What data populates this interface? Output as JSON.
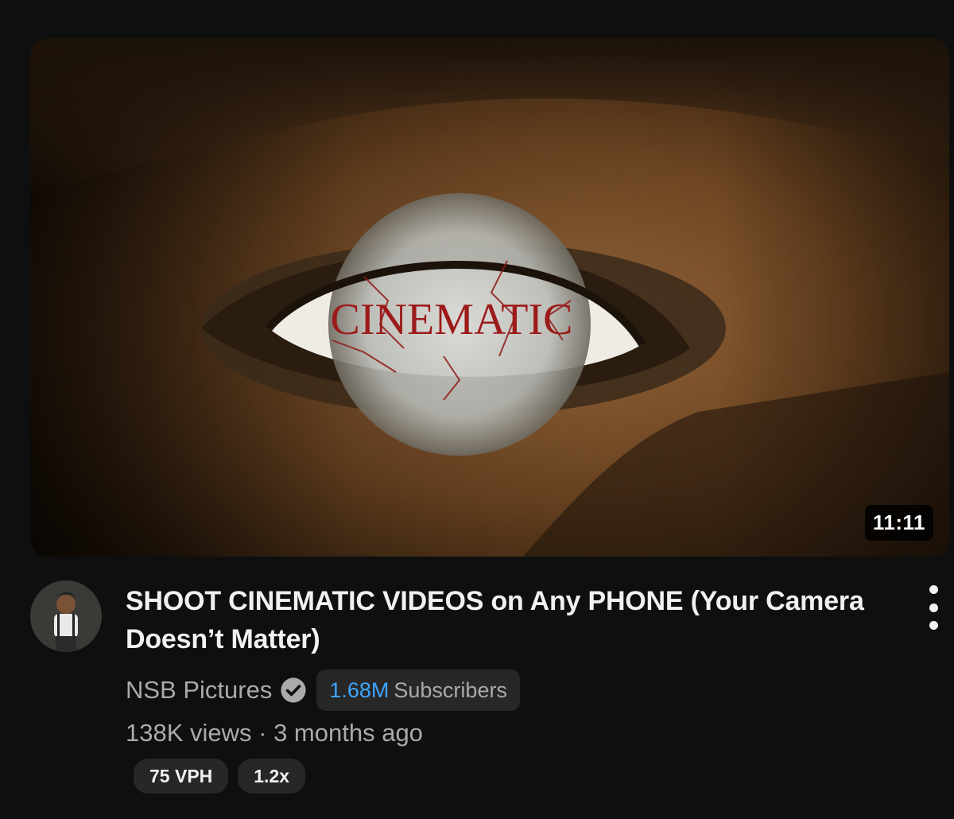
{
  "video": {
    "thumbnail_text": "CINEMATIC",
    "duration": "11:11",
    "title": "SHOOT CINEMATIC VIDEOS on Any PHONE (Your Camera Doesn’t Matter)",
    "stats": "138K views · 3 months ago"
  },
  "channel": {
    "name": "NSB Pictures",
    "verified_icon": "check-circle-icon",
    "subscriber_count": "1.68M",
    "subscriber_label": "Subscribers"
  },
  "badges": [
    {
      "label": "75 VPH"
    },
    {
      "label": "1.2x"
    }
  ],
  "menu_icon": "more-vertical-icon",
  "colors": {
    "background": "#0f0f0f",
    "text_primary": "#f1f1f1",
    "text_secondary": "#aaaaaa",
    "accent_blue": "#3ea6ff",
    "pill_bg": "#272727"
  }
}
